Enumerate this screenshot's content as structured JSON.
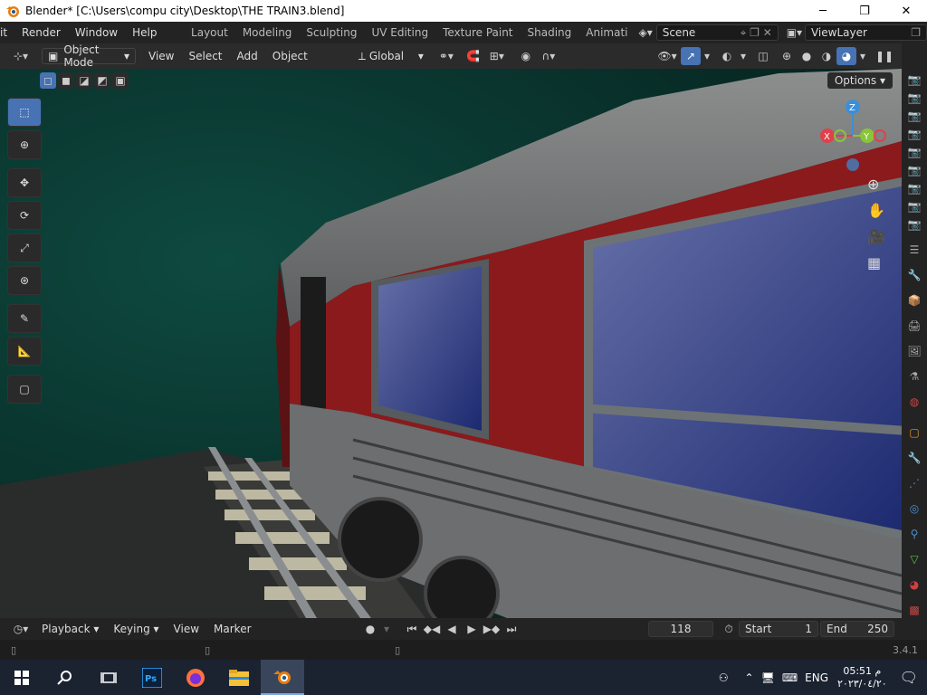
{
  "window": {
    "title": "Blender* [C:\\Users\\compu city\\Desktop\\THE TRAIN3.blend]",
    "minimize": "─",
    "maximize": "❐",
    "close": "✕"
  },
  "topbar": {
    "menus": [
      "it",
      "Render",
      "Window",
      "Help"
    ],
    "workspaces": [
      "Layout",
      "Modeling",
      "Sculpting",
      "UV Editing",
      "Texture Paint",
      "Shading",
      "Animati"
    ],
    "scene": "Scene",
    "view_layer": "ViewLayer"
  },
  "viewport_header": {
    "mode": "Object Mode",
    "menus": [
      "View",
      "Select",
      "Add",
      "Object"
    ],
    "transform_orientation": "Global"
  },
  "viewport": {
    "options_label": "Options",
    "gizmo": {
      "z": "Z",
      "x": "X",
      "y": "Y"
    }
  },
  "timeline": {
    "menus": [
      "Playback",
      "Keying",
      "View",
      "Marker"
    ],
    "current_frame": "118",
    "start_label": "Start",
    "start_value": "1",
    "end_label": "End",
    "end_value": "250"
  },
  "statusbar": {
    "version": "3.4.1"
  },
  "taskbar": {
    "language": "ENG",
    "time": "05:51 م",
    "date": "٢٠٢٣/٠٤/٢٠"
  },
  "colors": {
    "active_tool": "#4772b3",
    "x_axis": "#e0404a",
    "y_axis": "#8ac43a",
    "z_axis": "#3b8fd9",
    "train_red": "#8a1a1c"
  }
}
